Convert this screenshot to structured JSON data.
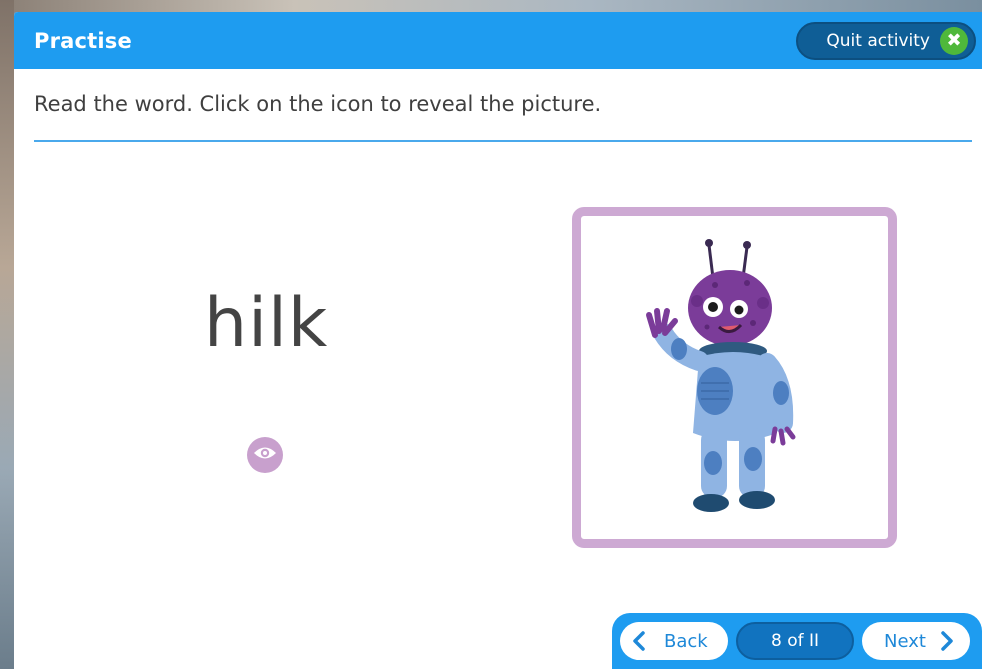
{
  "header": {
    "title": "Practise",
    "quit_label": "Quit activity",
    "quit_icon": "close-icon"
  },
  "instruction": "Read the word. Click on the icon to reveal the picture.",
  "word": "hilk",
  "reveal": {
    "icon": "eye-icon"
  },
  "picture": {
    "subject": "alien-in-spacesuit-illustration"
  },
  "navigation": {
    "back_label": "Back",
    "next_label": "Next",
    "page_indicator": "8 of II"
  },
  "colors": {
    "header_blue": "#1e9cf0",
    "quit_dark_blue": "#0f5e96",
    "quit_green": "#4fb83b",
    "card_border_lilac": "#cda9d3",
    "reveal_lilac": "#c8a0cd",
    "divider_blue": "#4aa9ec"
  }
}
